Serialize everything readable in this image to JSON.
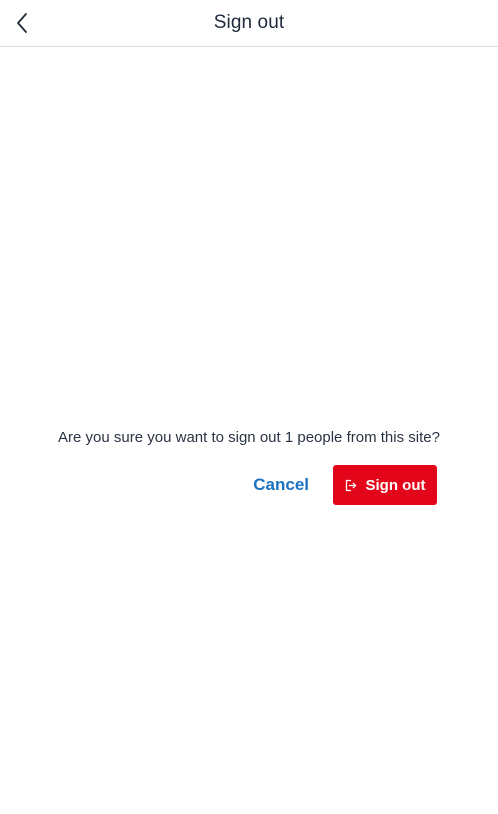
{
  "header": {
    "title": "Sign out",
    "back_icon": "chevron-left-icon"
  },
  "dialog": {
    "message": "Are you sure you want to sign out 1 people from this site?",
    "cancel_label": "Cancel",
    "confirm_label": "Sign out",
    "confirm_icon": "sign-out-icon"
  },
  "colors": {
    "accent_link": "#1b72c0",
    "danger_button": "#e3051a",
    "header_border": "#d9dce1",
    "title_text": "#1f2a3a"
  }
}
